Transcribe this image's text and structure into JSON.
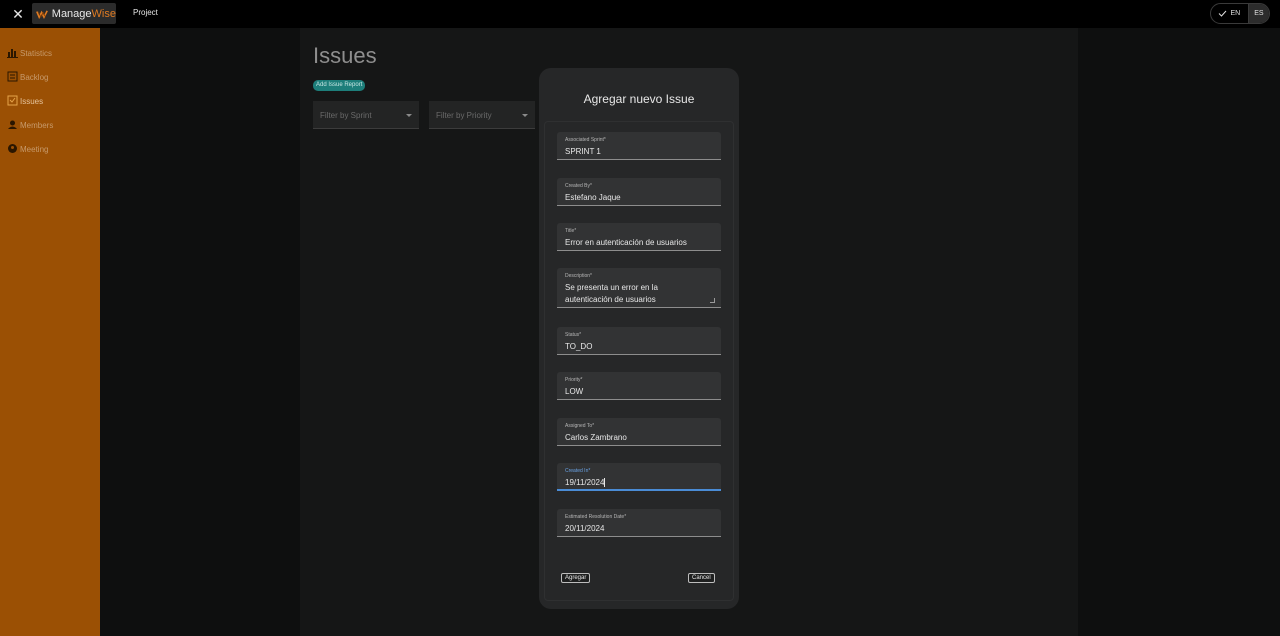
{
  "topbar": {
    "logo_text_primary": "Manage",
    "logo_text_accent": "Wise",
    "project_link": "Project",
    "lang_en": "EN",
    "lang_es": "ES"
  },
  "sidebar": {
    "items": [
      {
        "label": "Statistics",
        "icon": "bar-chart-icon"
      },
      {
        "label": "Backlog",
        "icon": "backlog-icon"
      },
      {
        "label": "Issues",
        "icon": "issues-icon"
      },
      {
        "label": "Members",
        "icon": "members-icon"
      },
      {
        "label": "Meeting",
        "icon": "meeting-icon"
      }
    ]
  },
  "main": {
    "title": "Issues",
    "add_button": "Add Issue Report",
    "filter_sprint": "Filter by Sprint",
    "filter_priority": "Filter by Priority"
  },
  "dialog": {
    "title": "Agregar nuevo Issue",
    "fields": [
      {
        "label": "Associated Sprint*",
        "value": "SPRINT 1"
      },
      {
        "label": "Created By*",
        "value": "Estefano Jaque"
      },
      {
        "label": "Title*",
        "value": "Error en autenticación de usuarios"
      },
      {
        "label": "Description*",
        "value": "Se presenta un error en la\nautenticación de usuarios"
      },
      {
        "label": "Status*",
        "value": "TO_DO"
      },
      {
        "label": "Priority*",
        "value": "LOW"
      },
      {
        "label": "Assigned To*",
        "value": "Carlos Zambrano"
      },
      {
        "label": "Created In*",
        "value": "19/11/2024"
      },
      {
        "label": "Estimated Resolution Date*",
        "value": "20/11/2024"
      }
    ],
    "submit_label": "Agregar",
    "cancel_label": "Cancel"
  },
  "colors": {
    "sidebar_bg": "#9b5004",
    "accent_orange": "#e07b22",
    "teal_button": "#1d7e7a",
    "focus_blue": "#4a8cd6"
  }
}
